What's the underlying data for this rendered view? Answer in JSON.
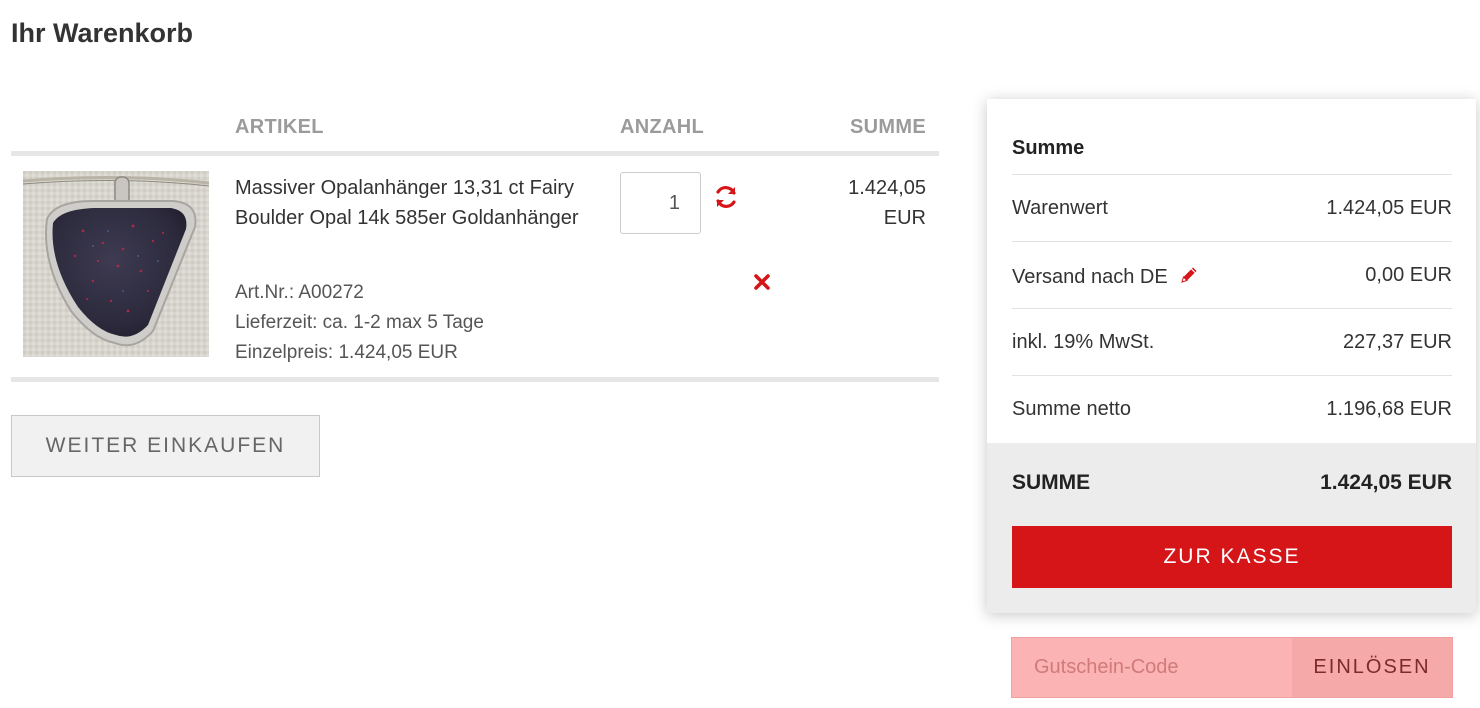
{
  "page": {
    "title": "Ihr Warenkorb"
  },
  "cart": {
    "headers": {
      "article": "ARTIKEL",
      "quantity": "ANZAHL",
      "sum": "SUMME"
    },
    "items": [
      {
        "name": "Massiver Opalanhänger 13,31 ct Fairy Boulder Opal 14k 585er Goldanhänger",
        "article_number": "Art.Nr.: A00272",
        "delivery_time": "Lieferzeit: ca. 1-2 max 5 Tage",
        "unit_price": "Einzelpreis: 1.424,05 EUR",
        "quantity": "1",
        "sum": "1.424,05 EUR",
        "refresh_icon": "refresh-icon",
        "remove_icon": "close-icon"
      }
    ],
    "continue_label": "WEITER EINKAUFEN"
  },
  "summary": {
    "title": "Summe",
    "lines": [
      {
        "label": "Warenwert",
        "value": "1.424,05 EUR"
      },
      {
        "label": "Versand nach DE",
        "value": "0,00 EUR",
        "icon": "pencil-icon"
      },
      {
        "label": "inkl. 19% MwSt.",
        "value": "227,37 EUR"
      },
      {
        "label": "Summe netto",
        "value": "1.196,68 EUR"
      }
    ],
    "total": {
      "label": "SUMME",
      "value": "1.424,05 EUR"
    },
    "checkout_label": "ZUR KASSE"
  },
  "coupon": {
    "placeholder": "Gutschein-Code",
    "button_label": "EINLÖSEN"
  },
  "colors": {
    "accent": "#d61519",
    "header_text": "#9b9b9b",
    "coupon_bg": "#fbb3b3",
    "total_bg": "#ececec"
  }
}
